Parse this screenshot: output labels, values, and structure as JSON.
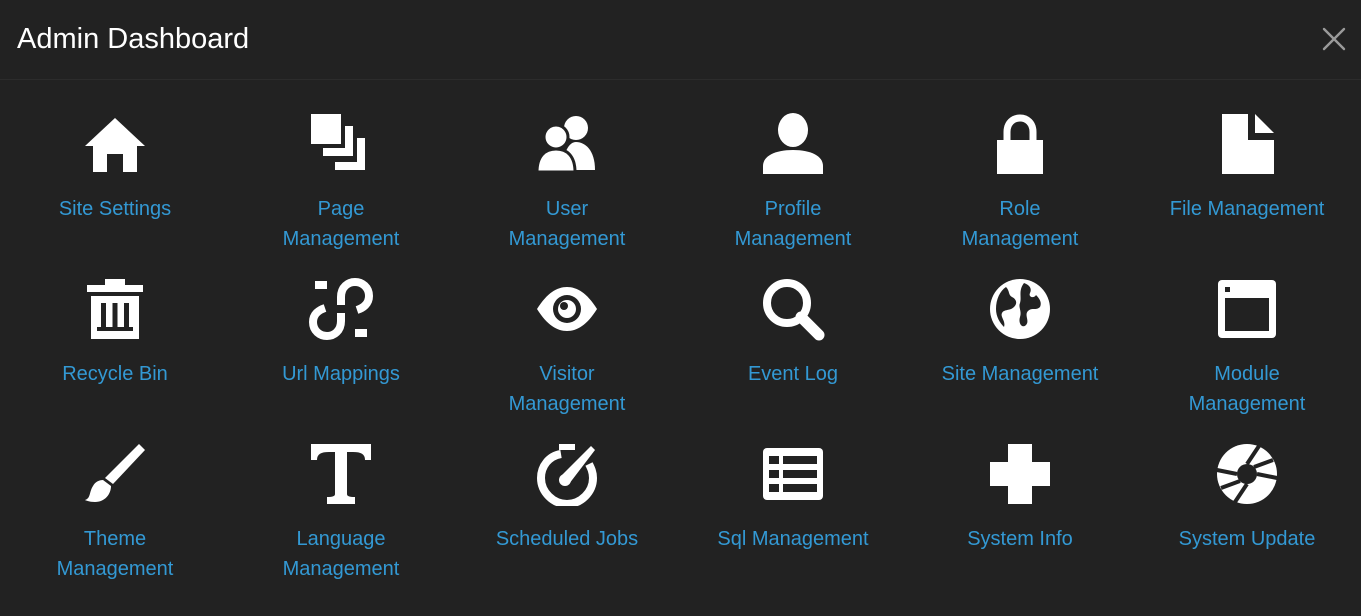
{
  "header": {
    "title": "Admin Dashboard"
  },
  "colors": {
    "background": "#222222",
    "label": "#3399d4",
    "icon": "#ffffff"
  },
  "items": [
    {
      "label": "Site Settings",
      "icon": "home-icon"
    },
    {
      "label": "Page Management",
      "icon": "pages-icon"
    },
    {
      "label": "User Management",
      "icon": "users-icon"
    },
    {
      "label": "Profile Management",
      "icon": "person-icon"
    },
    {
      "label": "Role Management",
      "icon": "lock-icon"
    },
    {
      "label": "File Management",
      "icon": "file-icon"
    },
    {
      "label": "Recycle Bin",
      "icon": "trash-icon"
    },
    {
      "label": "Url Mappings",
      "icon": "link-broken-icon"
    },
    {
      "label": "Visitor Management",
      "icon": "eye-icon"
    },
    {
      "label": "Event Log",
      "icon": "magnifier-icon"
    },
    {
      "label": "Site Management",
      "icon": "globe-icon"
    },
    {
      "label": "Module Management",
      "icon": "browser-icon"
    },
    {
      "label": "Theme Management",
      "icon": "brush-icon"
    },
    {
      "label": "Language Management",
      "icon": "text-icon"
    },
    {
      "label": "Scheduled Jobs",
      "icon": "timer-icon"
    },
    {
      "label": "Sql Management",
      "icon": "list-icon"
    },
    {
      "label": "System Info",
      "icon": "medical-cross-icon"
    },
    {
      "label": "System Update",
      "icon": "aperture-icon"
    }
  ]
}
